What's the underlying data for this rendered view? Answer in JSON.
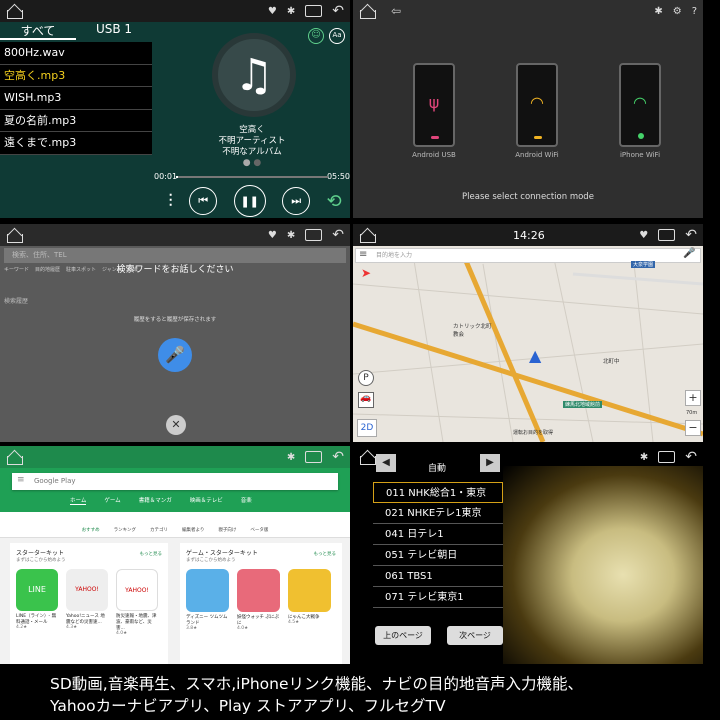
{
  "music": {
    "tabs": [
      "すべて",
      "USB 1"
    ],
    "files": [
      "800Hz.wav",
      "空高く.mp3",
      "WISH.mp3",
      "夏の名前.mp3",
      "遠くまで.mp3"
    ],
    "title": "空高く",
    "artist": "不明アーティスト",
    "album": "不明なアルバム",
    "elapsed": "00:01",
    "duration": "05:50",
    "font_btn": "Aa",
    "progress": 0.01
  },
  "connect": {
    "options": [
      "Android USB",
      "Android WiFi",
      "iPhone WiFi"
    ],
    "prompt": "Please select connection mode"
  },
  "voice": {
    "search_placeholder": "検索、住所、TEL",
    "prompt": "検索ワードをお話しください",
    "history_title": "検索履歴",
    "history_empty": "履歴をすると履歴が保存されます",
    "shortcuts": [
      "キーワード",
      "目的地履歴",
      "駐車スポット",
      "ジャンル",
      "地域"
    ]
  },
  "map": {
    "time": "14:26",
    "search_placeholder": "目的地を入力",
    "mode": "2D",
    "distance": "70m",
    "labels": [
      "カトリック北町教会",
      "北町中",
      "練馬北地域館前",
      "大泉学園",
      "運転お目的を取得"
    ]
  },
  "play": {
    "search": "Google Play",
    "tabs": [
      "ホーム",
      "ゲーム",
      "書籍＆マンガ",
      "映画＆テレビ",
      "音楽"
    ],
    "subnav": [
      "おすすめ",
      "ランキング",
      "カテゴリ",
      "編集者より",
      "親子向け",
      "ベータ版"
    ],
    "section1": {
      "title": "スターターキット",
      "sub": "まずはここから始めよう",
      "more": "もっと見る",
      "apps": [
        {
          "name": "LINE（ライン）- 無料通話・メール",
          "rating": "4.2★"
        },
        {
          "name": "Yahoo!ニュース 地震などの災害速...",
          "rating": "4.3★"
        },
        {
          "name": "防災速報・地震、津波、豪雨など、災害...",
          "rating": "4.0★"
        }
      ]
    },
    "section2": {
      "title": "ゲーム・スターターキット",
      "sub": "まずはここから始めよう",
      "more": "もっと見る",
      "apps": [
        {
          "name": "ディズニー ツムツム ランド",
          "rating": "3.8★"
        },
        {
          "name": "妖怪ウォッチ ぷにぷに",
          "rating": "4.0★"
        },
        {
          "name": "にゃんこ大戦争",
          "rating": "4.5★"
        }
      ]
    }
  },
  "tv": {
    "mode": "自動",
    "channels": [
      "011 NHK総合1・東京",
      "021 NHKEテレ1東京",
      "041 日テレ1",
      "051 テレビ朝日",
      "061 TBS1",
      "071 テレビ東京1"
    ],
    "prev": "上のページ",
    "next": "次ページ"
  },
  "caption": [
    "SD動画,音楽再生、スマホ,iPhoneリンク機能、ナビの目的地音声入力機能、",
    "Yahooカーナビアプリ、Play ストアアプリ、フルセグTV"
  ]
}
